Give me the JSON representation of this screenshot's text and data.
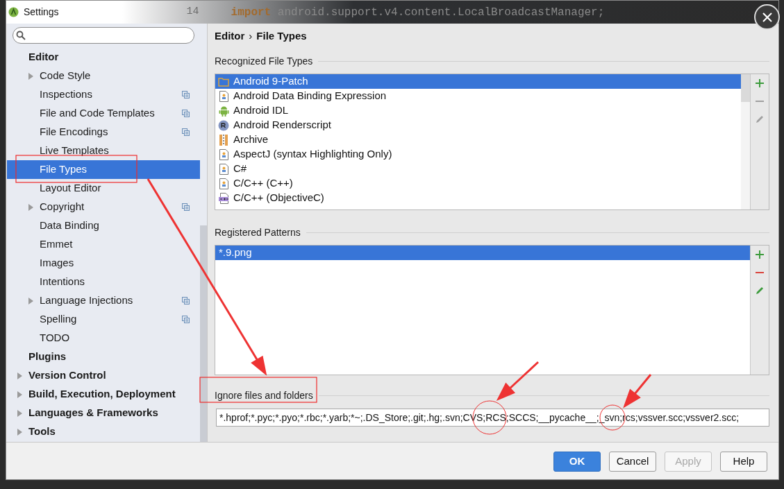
{
  "window": {
    "title": "Settings"
  },
  "background_code": {
    "line_number": "14",
    "keyword": "import",
    "text": "android.support.v4.content.LocalBroadcastManager;"
  },
  "sidebar": {
    "items": [
      {
        "label": "Editor",
        "selected": false,
        "children": [
          {
            "label": "Code Style",
            "selected": false,
            "expanded": false,
            "per_project": false
          },
          {
            "label": "Inspections",
            "selected": false,
            "per_project": true
          },
          {
            "label": "File and Code Templates",
            "selected": false,
            "per_project": true
          },
          {
            "label": "File Encodings",
            "selected": false,
            "per_project": true
          },
          {
            "label": "Live Templates",
            "selected": false,
            "per_project": false
          },
          {
            "label": "File Types",
            "selected": true,
            "per_project": false
          },
          {
            "label": "Layout Editor",
            "selected": false,
            "per_project": false
          },
          {
            "label": "Copyright",
            "selected": false,
            "expanded": false,
            "per_project": true
          },
          {
            "label": "Data Binding",
            "selected": false,
            "per_project": false
          },
          {
            "label": "Emmet",
            "selected": false,
            "per_project": false
          },
          {
            "label": "Images",
            "selected": false,
            "per_project": false
          },
          {
            "label": "Intentions",
            "selected": false,
            "per_project": false
          },
          {
            "label": "Language Injections",
            "selected": false,
            "expanded": false,
            "per_project": true
          },
          {
            "label": "Spelling",
            "selected": false,
            "per_project": true
          },
          {
            "label": "TODO",
            "selected": false,
            "per_project": false
          }
        ]
      },
      {
        "label": "Plugins",
        "selected": false
      },
      {
        "label": "Version Control",
        "selected": false,
        "expanded": false
      },
      {
        "label": "Build, Execution, Deployment",
        "selected": false,
        "expanded": false
      },
      {
        "label": "Languages & Frameworks",
        "selected": false,
        "expanded": false
      },
      {
        "label": "Tools",
        "selected": false,
        "expanded": false
      }
    ]
  },
  "breadcrumb": {
    "items": [
      "Editor",
      "File Types"
    ],
    "separator": "›"
  },
  "recognized_file_types": {
    "title": "Recognized File Types",
    "rows": [
      {
        "label": "Android 9-Patch",
        "kind": "folder",
        "selected": true
      },
      {
        "label": "Android Data Binding Expression",
        "kind": "file",
        "selected": false
      },
      {
        "label": "Android IDL",
        "kind": "android",
        "selected": false
      },
      {
        "label": "Android Renderscript",
        "kind": "rs",
        "selected": false
      },
      {
        "label": "Archive",
        "kind": "archive",
        "selected": false
      },
      {
        "label": "AspectJ (syntax Highlighting Only)",
        "kind": "file",
        "selected": false
      },
      {
        "label": "C#",
        "kind": "file",
        "selected": false
      },
      {
        "label": "C/C++ (C++)",
        "kind": "file",
        "selected": false
      },
      {
        "label": "C/C++ (ObjectiveC)",
        "kind": "cpp",
        "selected": false
      }
    ],
    "toolbar": [
      {
        "kind": "add",
        "disabled": false
      },
      {
        "kind": "remove",
        "disabled": true
      },
      {
        "kind": "edit",
        "disabled": true
      }
    ]
  },
  "registered_patterns": {
    "title": "Registered Patterns",
    "rows": [
      {
        "label": "*.9.png",
        "selected": true
      }
    ],
    "toolbar": [
      {
        "kind": "add",
        "disabled": false
      },
      {
        "kind": "remove",
        "disabled": false
      },
      {
        "kind": "edit",
        "disabled": false
      }
    ]
  },
  "ignore": {
    "label": "Ignore files and folders",
    "value": "*.hprof;*.pyc;*.pyo;*.rbc;*.yarb;*~;.DS_Store;.git;.hg;.svn;CVS;RCS;SCCS;__pycache__;_svn;rcs;vssver.scc;vssver2.scc;"
  },
  "buttons": [
    {
      "label": "OK",
      "primary": true,
      "disabled": false
    },
    {
      "label": "Cancel",
      "primary": false,
      "disabled": false
    },
    {
      "label": "Apply",
      "primary": false,
      "disabled": true
    },
    {
      "label": "Help",
      "primary": false,
      "disabled": false
    }
  ]
}
